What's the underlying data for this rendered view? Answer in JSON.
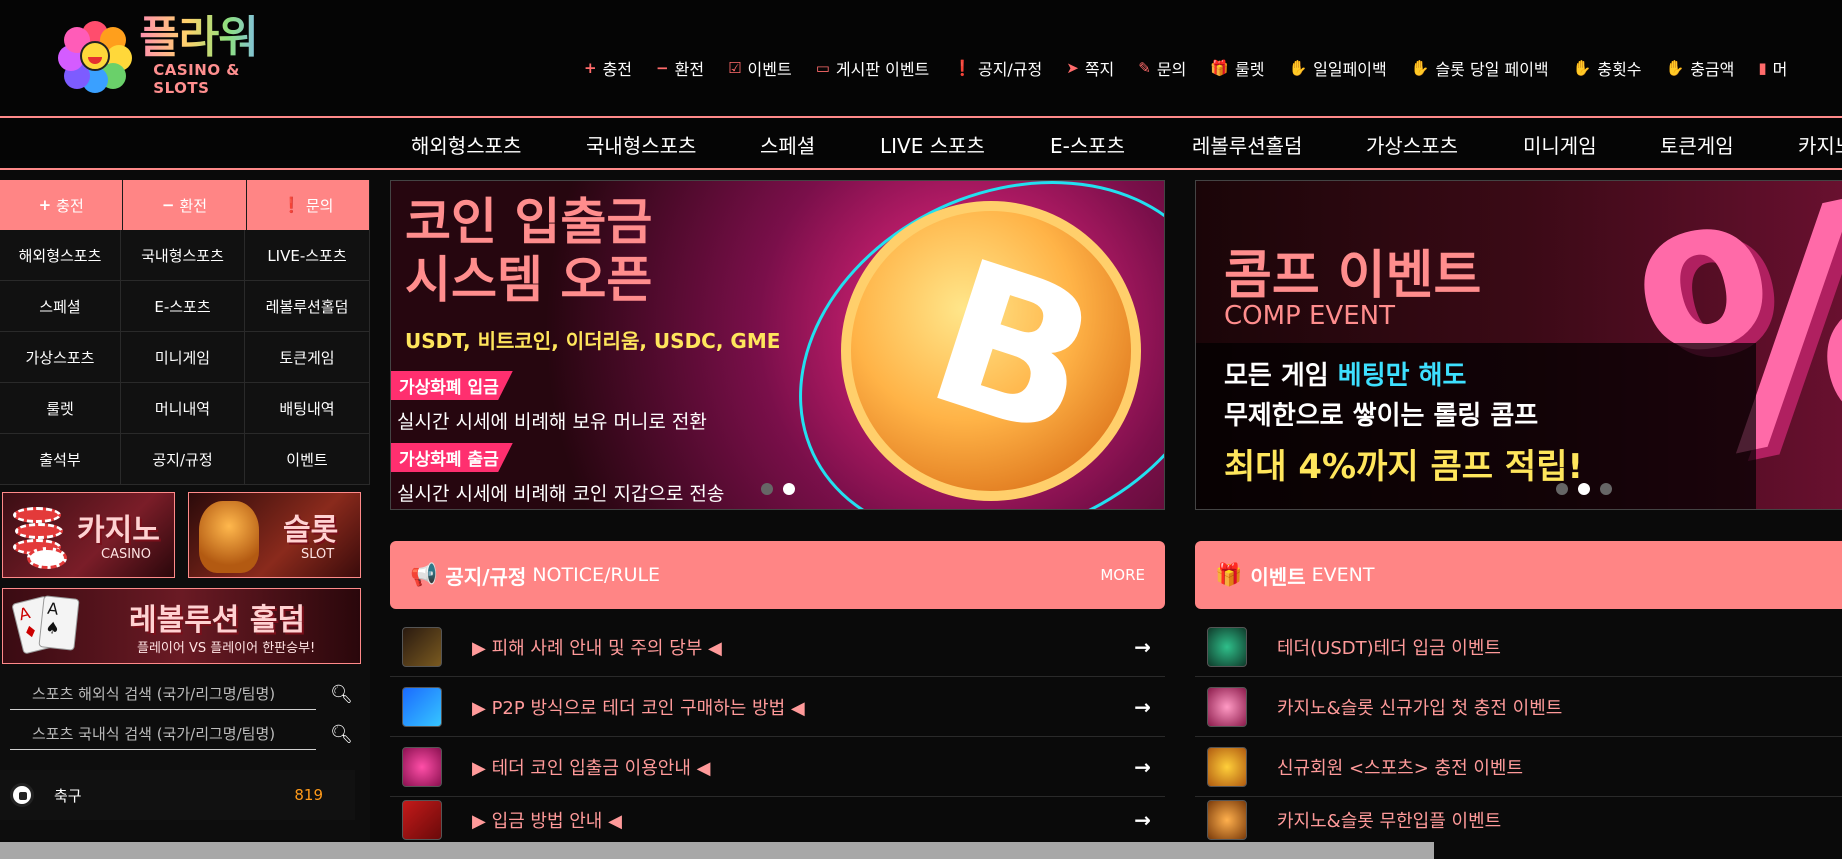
{
  "logo": {
    "title": "플라워",
    "subtitle": "CASINO & SLOTS"
  },
  "topmenu": [
    {
      "icon": "plus-icon",
      "glyph": "+",
      "label": "충전"
    },
    {
      "icon": "minus-icon",
      "glyph": "−",
      "label": "환전"
    },
    {
      "icon": "calendar-icon",
      "glyph": "☑",
      "label": "이벤트"
    },
    {
      "icon": "board-icon",
      "glyph": "▭",
      "label": "게시판 이벤트"
    },
    {
      "icon": "alert-icon",
      "glyph": "❗",
      "label": "공지/규정"
    },
    {
      "icon": "paper-plane-icon",
      "glyph": "➤",
      "label": "쪽지"
    },
    {
      "icon": "edit-icon",
      "glyph": "✎",
      "label": "문의"
    },
    {
      "icon": "gift-icon",
      "glyph": "🎁",
      "label": "룰렛"
    },
    {
      "icon": "hand-coin-icon",
      "glyph": "✋",
      "label": "일일페이백"
    },
    {
      "icon": "hand-coin-icon",
      "glyph": "✋",
      "label": "슬롯 당일 페이백"
    },
    {
      "icon": "hand-coin-icon",
      "glyph": "✋",
      "label": "충횟수"
    },
    {
      "icon": "hand-coin-icon",
      "glyph": "✋",
      "label": "충금액"
    },
    {
      "icon": "clipboard-icon",
      "glyph": "▮",
      "label": "머"
    }
  ],
  "nav": [
    "해외형스포츠",
    "국내형스포츠",
    "스페셜",
    "LIVE 스포츠",
    "E-스포츠",
    "레볼루션홀덤",
    "가상스포츠",
    "미니게임",
    "토큰게임",
    "카지노"
  ],
  "sidebar": {
    "buttons": [
      {
        "glyph": "+",
        "label": "충전"
      },
      {
        "glyph": "−",
        "label": "환전"
      },
      {
        "glyph": "❗",
        "label": "문의"
      }
    ],
    "grid": [
      "해외형스포츠",
      "국내형스포츠",
      "LIVE-스포츠",
      "스페셜",
      "E-스포츠",
      "레볼루션홀덤",
      "가상스포츠",
      "미니게임",
      "토큰게임",
      "룰렛",
      "머니내역",
      "배팅내역",
      "출석부",
      "공지/규정",
      "이벤트"
    ],
    "banner_casino": {
      "title": "카지노",
      "sub": "CASINO"
    },
    "banner_slot": {
      "title": "슬롯",
      "sub": "SLOT"
    },
    "banner_holdem": {
      "title": "레볼루션 홀덤",
      "sub": "플레이어 VS 플레이어 한판승부!"
    },
    "search1_placeholder": "스포츠 해외식 검색 (국가/리그명/팀명)",
    "search2_placeholder": "스포츠 국내식 검색 (국가/리그명/팀명)",
    "sport": {
      "name": "축구",
      "count": "819"
    }
  },
  "hero1": {
    "line1": "코인 입출금",
    "line2": "시스템 오픈",
    "coins": "USDT, 비트코인, 이더리움, USDC, GME",
    "tag1": "가상화폐 입금",
    "desc1": "실시간 시세에 비례해 보유 머니로 전환",
    "tag2": "가상화폐 출금",
    "desc2": "실시간 시세에 비례해 코인 지갑으로 전송"
  },
  "hero2": {
    "line1": "콤프 이벤트",
    "line2": "COMP EVENT",
    "desc1a": "모든 게임 ",
    "desc1b": "베팅만 해도",
    "desc2": "무제한으로 쌓이는 롤링 콤프",
    "desc3": "최대 4%까지 콤프 적립!"
  },
  "notice": {
    "title": "공지/규정",
    "sub": "NOTICE/RULE",
    "more": "MORE",
    "items": [
      "▶ 피해 사례 안내 및 주의 당부 ◀",
      "▶ P2P 방식으로 테더 코인 구매하는 방법 ◀",
      "▶ 테더 코인 입출금 이용안내 ◀",
      "▶ 입금 방법 안내 ◀"
    ]
  },
  "event": {
    "title": "이벤트",
    "sub": "EVENT",
    "items": [
      "테더(USDT)테더 입금 이벤트",
      "카지노&슬롯 신규가입 첫 충전 이벤트",
      "신규회원 <스포츠> 충전 이벤트",
      "카지노&슬롯 무한입플 이벤트"
    ]
  },
  "colors": {
    "accent": "#ff8585",
    "link": "#ff9a9a",
    "count": "#ff9a1a",
    "bg": "#0a0a0a"
  }
}
